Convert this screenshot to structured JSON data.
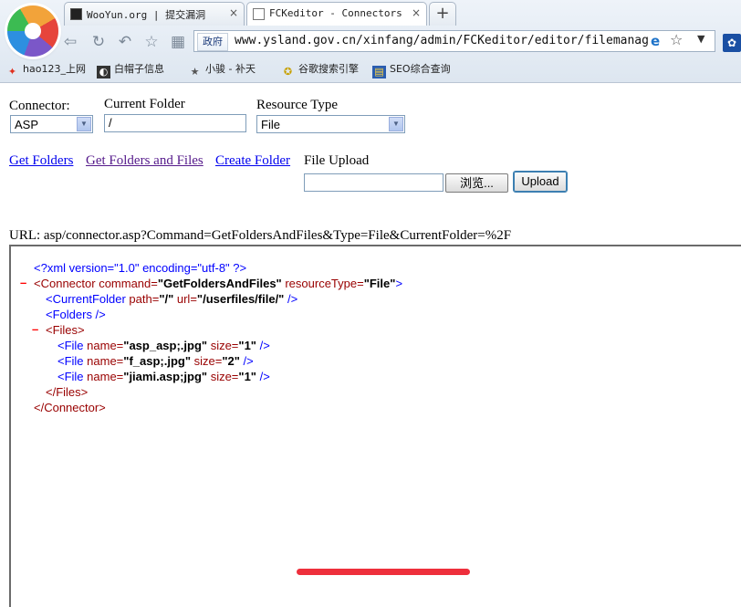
{
  "browser": {
    "tabs": [
      {
        "title": "WooYun.org | 提交漏洞",
        "close": "×"
      },
      {
        "title": "FCKeditor - Connectors Te",
        "close": "×"
      }
    ],
    "new_tab": "+",
    "security_badge": "政府",
    "url": "www.ysland.gov.cn/xinfang/admin/FCKeditor/editor/filemanager",
    "bookmarks": [
      "hao123_上网",
      "白帽子信息",
      "小骏 - 补天",
      "谷歌搜索引擎",
      "SEO综合查询"
    ]
  },
  "form": {
    "connector_label": "Connector:",
    "connector_value": "ASP",
    "folder_label": "Current Folder",
    "folder_value": "/",
    "resource_label": "Resource Type",
    "resource_value": "File",
    "links": [
      "Get Folders",
      "Get Folders and Files",
      "Create Folder"
    ],
    "upload_label": "File Upload",
    "browse_label": "浏览...",
    "upload_button": "Upload",
    "url_line": "URL: asp/connector.asp?Command=GetFoldersAndFiles&Type=File&CurrentFolder=%2F"
  },
  "xml": {
    "decl": "<?xml version=\"1.0\" encoding=\"utf-8\" ?>",
    "connector_open_a": "<Connector",
    "connector_attr1": " command=",
    "connector_val1": "\"GetFoldersAndFiles\"",
    "connector_attr2": " resourceType=",
    "connector_val2": "\"File\"",
    "connector_close_bracket": ">",
    "current_folder_a": "<CurrentFolder",
    "current_folder_attr1": " path=",
    "current_folder_val1": "\"/\"",
    "current_folder_attr2": " url=",
    "current_folder_val2": "\"/userfiles/file/\"",
    "current_folder_end": " />",
    "folders": "<Folders />",
    "files_open": "<Files>",
    "file_tag": "<File",
    "name_attr": " name=",
    "size_attr": " size=",
    "self_close": " />",
    "files": [
      {
        "name": "\"asp_asp;.jpg\"",
        "size": "\"1\""
      },
      {
        "name": "\"f_asp;.jpg\"",
        "size": "\"2\""
      },
      {
        "name": "\"jiami.asp;jpg\"",
        "size": "\"1\""
      }
    ],
    "files_close": "</Files>",
    "connector_close": "</Connector>",
    "collapse_marker": "–"
  }
}
